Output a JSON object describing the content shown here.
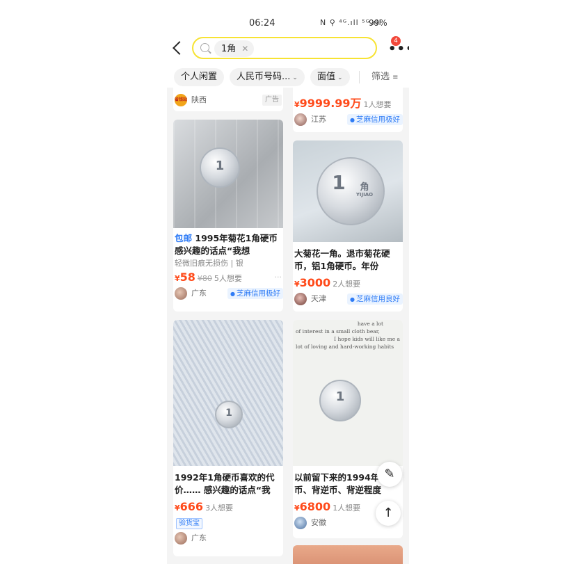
{
  "status_bar": {
    "time": "06:24",
    "icons": "N ⚲ ⁴ᴳ.ıll ⁵ᴳ.ıll",
    "battery": "99%"
  },
  "search": {
    "query": "1角"
  },
  "header": {
    "more_badge": "4"
  },
  "filters": {
    "items": [
      "个人闲置",
      "人民币号码...",
      "面值"
    ],
    "last": "筛选"
  },
  "left_column": {
    "top_card": {
      "seller_location": "陕西",
      "seller_logo_text": "省钱站",
      "ad_label": "广告"
    },
    "card1": {
      "tag": "包邮",
      "title": "1995年菊花1角硬币 感兴趣的话点“我想",
      "subinfo": "轻微旧痕无损伤 | 银",
      "price": "58",
      "original_price": "¥80",
      "want": "5人想要",
      "location": "广东",
      "credit": "芝麻信用极好"
    },
    "card2": {
      "title": "1992年1角硬币喜欢的代价…… 感兴趣的话点“我",
      "price": "666",
      "want": "3人想要",
      "shipping_badge": "验货宝",
      "location": "广东"
    }
  },
  "right_column": {
    "top_card": {
      "price": "9999.99万",
      "want": "1人想要",
      "location": "江苏",
      "credit": "芝麻信用极好"
    },
    "card1": {
      "title": "大菊花一角。退市菊花硬币，铝1角硬币。年份",
      "price": "3000",
      "want": "2人想要",
      "location": "天津",
      "credit": "芝麻信用良好",
      "coin_value": "1",
      "coin_unit": "角",
      "coin_pinyin": "YIJIAO"
    },
    "card2": {
      "photo_text": [
        "have a lot",
        "of interest in a small cloth bear,",
        "I hope kids will like me a",
        "lot of loving and hard-working habits"
      ],
      "title": "以前留下来的1994年硬币、背逆币、背逆程度",
      "price": "6800",
      "want": "1人想要",
      "location": "安徽"
    }
  },
  "currency_symbol": "¥",
  "floating": {
    "note_icon": "✎",
    "top_icon": "↑"
  }
}
